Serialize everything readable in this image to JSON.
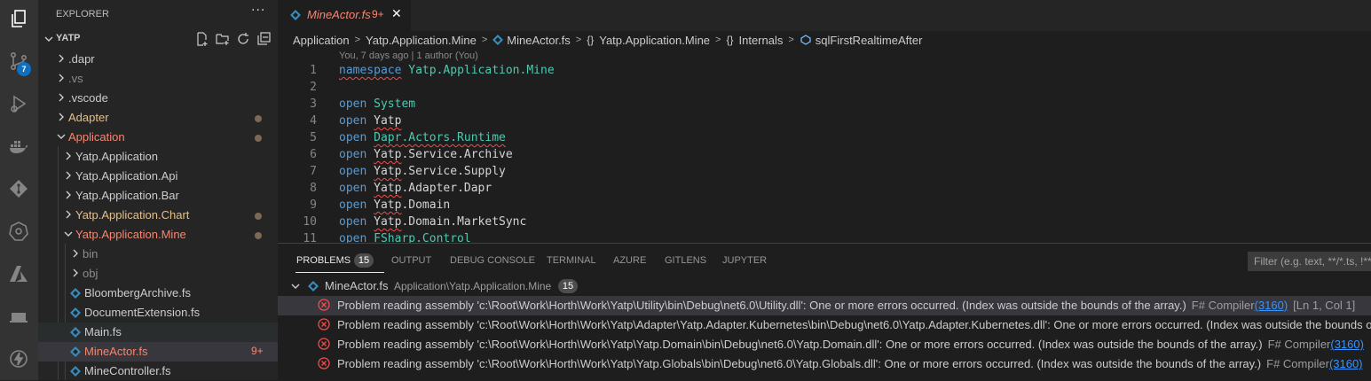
{
  "activity_bar": {
    "scm_badge": "7"
  },
  "sidebar": {
    "title": "EXPLORER",
    "root": "YATP",
    "items": [
      {
        "label": ".dapr",
        "color": "#cccccc"
      },
      {
        "label": ".vs",
        "color": "#8c8c8c"
      },
      {
        "label": ".vscode",
        "color": "#cccccc"
      },
      {
        "label": "Adapter",
        "color": "#e2c08d"
      },
      {
        "label": "Application",
        "color": "#f48771"
      },
      {
        "label": "Yatp.Application",
        "color": "#cccccc"
      },
      {
        "label": "Yatp.Application.Api",
        "color": "#cccccc"
      },
      {
        "label": "Yatp.Application.Bar",
        "color": "#cccccc"
      },
      {
        "label": "Yatp.Application.Chart",
        "color": "#e2c08d"
      },
      {
        "label": "Yatp.Application.Mine",
        "color": "#f48771"
      },
      {
        "label": "bin",
        "color": "#8c8c8c"
      },
      {
        "label": "obj",
        "color": "#8c8c8c"
      },
      {
        "label": "BloombergArchive.fs",
        "color": "#cccccc"
      },
      {
        "label": "DocumentExtension.fs",
        "color": "#cccccc"
      },
      {
        "label": "Main.fs",
        "color": "#cccccc"
      },
      {
        "label": "MineActor.fs",
        "color": "#f48771",
        "badge": "9+"
      },
      {
        "label": "MineController.fs",
        "color": "#cccccc"
      }
    ]
  },
  "tab": {
    "filename": "MineActor.fs",
    "problems": "9+"
  },
  "breadcrumb": {
    "items": [
      "Application",
      "Yatp.Application.Mine",
      "MineActor.fs",
      "Yatp.Application.Mine",
      "Internals",
      "sqlFirstRealtimeAfter"
    ]
  },
  "editor": {
    "blame": "You, 7 days ago | 1 author (You)",
    "lines": [
      {
        "n": "1",
        "kw": "namespace",
        "rest": "Yatp.Application.Mine"
      },
      {
        "n": "2",
        "kw": "",
        "rest": ""
      },
      {
        "n": "3",
        "kw": "open",
        "rest": "System"
      },
      {
        "n": "4",
        "kw": "open",
        "rest": "Yatp"
      },
      {
        "n": "5",
        "kw": "open",
        "rest": "Dapr.Actors.Runtime"
      },
      {
        "n": "6",
        "kw": "open",
        "rest": "Yatp.Service.Archive"
      },
      {
        "n": "7",
        "kw": "open",
        "rest": "Yatp.Service.Supply"
      },
      {
        "n": "8",
        "kw": "open",
        "rest": "Yatp.Adapter.Dapr"
      },
      {
        "n": "9",
        "kw": "open",
        "rest": "Yatp.Domain"
      },
      {
        "n": "10",
        "kw": "open",
        "rest": "Yatp.Domain.MarketSync"
      },
      {
        "n": "11",
        "kw": "open",
        "rest": "FSharp.Control"
      }
    ]
  },
  "panel": {
    "tabs": [
      "PROBLEMS",
      "OUTPUT",
      "DEBUG CONSOLE",
      "TERMINAL",
      "AZURE",
      "GITLENS",
      "JUPYTER"
    ],
    "problems_count": "15",
    "filter_placeholder": "Filter (e.g. text, **/*.ts, !**/node_modules/**)",
    "file": {
      "name": "MineActor.fs",
      "path": "Application\\Yatp.Application.Mine",
      "count": "15"
    },
    "problems": [
      {
        "msg": "Problem reading assembly 'c:\\Root\\Work\\Horth\\Work\\Yatp\\Utility\\bin\\Debug\\net6.0\\Utility.dll': One or more errors occurred. (Index was outside the bounds of the array.)",
        "source": "F# Compiler",
        "code": "(3160)",
        "pos": "[Ln 1, Col 1]"
      },
      {
        "msg": "Problem reading assembly 'c:\\Root\\Work\\Horth\\Work\\Yatp\\Adapter\\Yatp.Adapter.Kubernetes\\bin\\Debug\\net6.0\\Yatp.Adapter.Kubernetes.dll': One or more errors occurred. (Index was outside the bounds of the array.)",
        "source": "",
        "code": "",
        "pos": ""
      },
      {
        "msg": "Problem reading assembly 'c:\\Root\\Work\\Horth\\Work\\Yatp\\Yatp.Domain\\bin\\Debug\\net6.0\\Yatp.Domain.dll': One or more errors occurred. (Index was outside the bounds of the array.)",
        "source": "F# Compiler",
        "code": "(3160)",
        "pos": ""
      },
      {
        "msg": "Problem reading assembly 'c:\\Root\\Work\\Horth\\Work\\Yatp\\Yatp.Globals\\bin\\Debug\\net6.0\\Yatp.Globals.dll': One or more errors occurred. (Index was outside the bounds of the array.)",
        "source": "F# Compiler",
        "code": "(3160)",
        "pos": ""
      }
    ]
  }
}
